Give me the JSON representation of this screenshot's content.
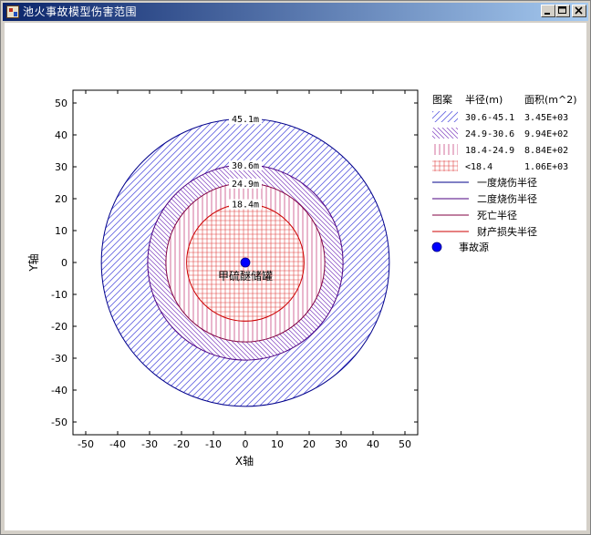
{
  "window": {
    "title": "池火事故模型伤害范围",
    "title_bar_color": "#0a246a"
  },
  "chart_data": {
    "type": "scatter",
    "xlabel": "X轴",
    "ylabel": "Y轴",
    "xlim": [
      -54,
      54
    ],
    "ylim": [
      -54,
      54
    ],
    "x_ticks": [
      -50,
      -40,
      -30,
      -20,
      -10,
      0,
      10,
      20,
      30,
      40,
      50
    ],
    "y_ticks": [
      -50,
      -40,
      -30,
      -20,
      -10,
      0,
      10,
      20,
      30,
      40,
      50
    ],
    "x_tick_labels": [
      "-50",
      "-40",
      "-30",
      "-20",
      "-10",
      "0",
      "10",
      "20",
      "30",
      "40",
      "50"
    ],
    "y_tick_labels": [
      "-50",
      "-40",
      "-30",
      "-20",
      "-10",
      "0",
      "10",
      "20",
      "30",
      "40",
      "50"
    ],
    "grid": false,
    "legend_position": "right",
    "circles": [
      {
        "radius": 45.1,
        "label": "45.1m",
        "color": "#00008b",
        "name": "一度烧伤半径"
      },
      {
        "radius": 30.6,
        "label": "30.6m",
        "color": "#4b0082",
        "name": "二度烧伤半径"
      },
      {
        "radius": 24.9,
        "label": "24.9m",
        "color": "#800040",
        "name": "死亡半径"
      },
      {
        "radius": 18.4,
        "label": "18.4m",
        "color": "#cc0000",
        "name": "财产损失半径"
      }
    ],
    "zones": [
      {
        "range": "30.6-45.1",
        "area": "3.45E+03",
        "pattern": "diag-wide",
        "color": "#6060e0"
      },
      {
        "range": "24.9-30.6",
        "area": "9.94E+02",
        "pattern": "diag-dense",
        "color": "#8040c0"
      },
      {
        "range": "18.4-24.9",
        "area": "8.84E+02",
        "pattern": "vertical",
        "color": "#c03070"
      },
      {
        "range": "<18.4",
        "area": "1.06E+03",
        "pattern": "grid",
        "color": "#e04040"
      }
    ],
    "source_point": {
      "x": 0,
      "y": 0,
      "label": "甲硫醚储罐",
      "color": "#0000ff",
      "name": "事故源"
    }
  },
  "legend": {
    "header_pattern": "图案",
    "header_radius": "半径(m)",
    "header_area": "面积(m^2)",
    "source_label": "事故源"
  }
}
